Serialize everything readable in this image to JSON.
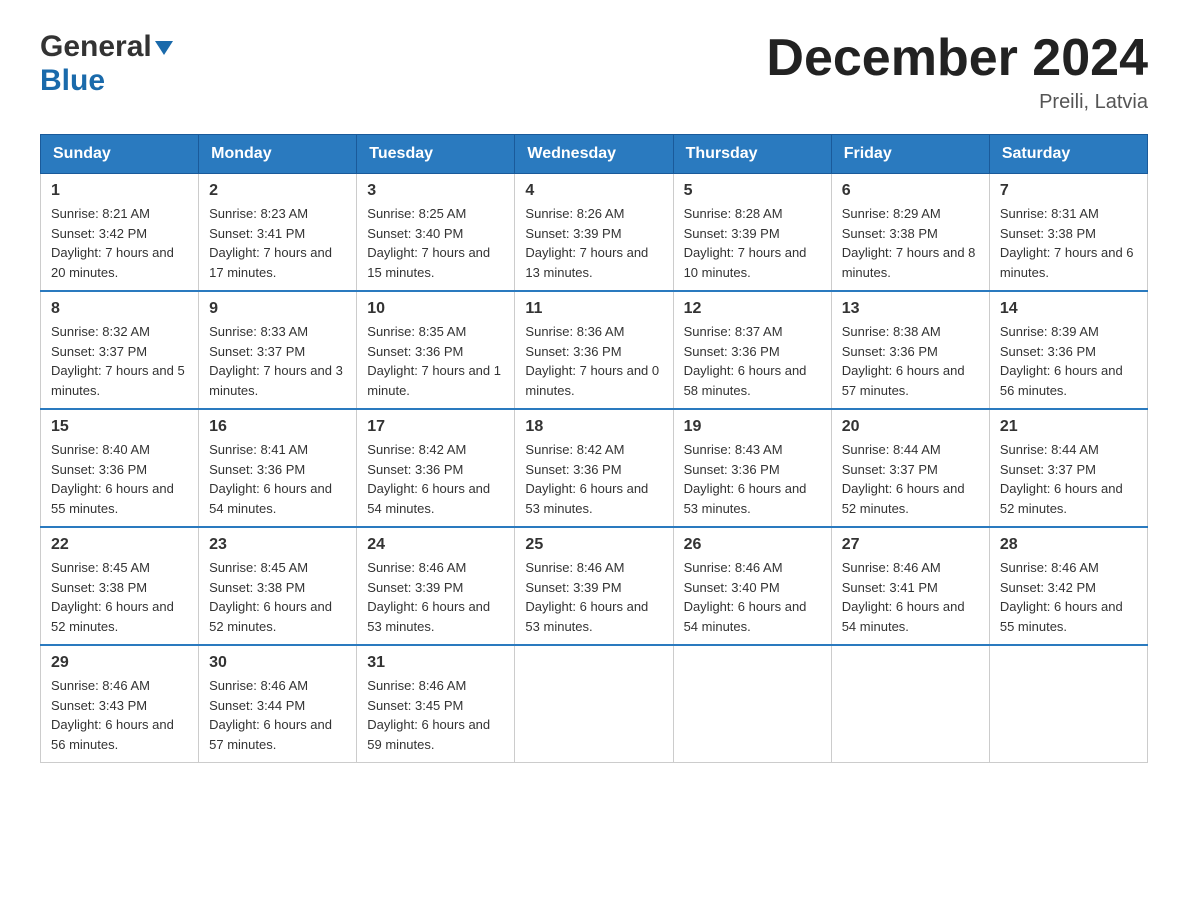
{
  "header": {
    "logo_general": "General",
    "logo_blue": "Blue",
    "title": "December 2024",
    "location": "Preili, Latvia"
  },
  "days_of_week": [
    "Sunday",
    "Monday",
    "Tuesday",
    "Wednesday",
    "Thursday",
    "Friday",
    "Saturday"
  ],
  "weeks": [
    [
      {
        "num": "1",
        "sunrise": "8:21 AM",
        "sunset": "3:42 PM",
        "daylight": "7 hours and 20 minutes."
      },
      {
        "num": "2",
        "sunrise": "8:23 AM",
        "sunset": "3:41 PM",
        "daylight": "7 hours and 17 minutes."
      },
      {
        "num": "3",
        "sunrise": "8:25 AM",
        "sunset": "3:40 PM",
        "daylight": "7 hours and 15 minutes."
      },
      {
        "num": "4",
        "sunrise": "8:26 AM",
        "sunset": "3:39 PM",
        "daylight": "7 hours and 13 minutes."
      },
      {
        "num": "5",
        "sunrise": "8:28 AM",
        "sunset": "3:39 PM",
        "daylight": "7 hours and 10 minutes."
      },
      {
        "num": "6",
        "sunrise": "8:29 AM",
        "sunset": "3:38 PM",
        "daylight": "7 hours and 8 minutes."
      },
      {
        "num": "7",
        "sunrise": "8:31 AM",
        "sunset": "3:38 PM",
        "daylight": "7 hours and 6 minutes."
      }
    ],
    [
      {
        "num": "8",
        "sunrise": "8:32 AM",
        "sunset": "3:37 PM",
        "daylight": "7 hours and 5 minutes."
      },
      {
        "num": "9",
        "sunrise": "8:33 AM",
        "sunset": "3:37 PM",
        "daylight": "7 hours and 3 minutes."
      },
      {
        "num": "10",
        "sunrise": "8:35 AM",
        "sunset": "3:36 PM",
        "daylight": "7 hours and 1 minute."
      },
      {
        "num": "11",
        "sunrise": "8:36 AM",
        "sunset": "3:36 PM",
        "daylight": "7 hours and 0 minutes."
      },
      {
        "num": "12",
        "sunrise": "8:37 AM",
        "sunset": "3:36 PM",
        "daylight": "6 hours and 58 minutes."
      },
      {
        "num": "13",
        "sunrise": "8:38 AM",
        "sunset": "3:36 PM",
        "daylight": "6 hours and 57 minutes."
      },
      {
        "num": "14",
        "sunrise": "8:39 AM",
        "sunset": "3:36 PM",
        "daylight": "6 hours and 56 minutes."
      }
    ],
    [
      {
        "num": "15",
        "sunrise": "8:40 AM",
        "sunset": "3:36 PM",
        "daylight": "6 hours and 55 minutes."
      },
      {
        "num": "16",
        "sunrise": "8:41 AM",
        "sunset": "3:36 PM",
        "daylight": "6 hours and 54 minutes."
      },
      {
        "num": "17",
        "sunrise": "8:42 AM",
        "sunset": "3:36 PM",
        "daylight": "6 hours and 54 minutes."
      },
      {
        "num": "18",
        "sunrise": "8:42 AM",
        "sunset": "3:36 PM",
        "daylight": "6 hours and 53 minutes."
      },
      {
        "num": "19",
        "sunrise": "8:43 AM",
        "sunset": "3:36 PM",
        "daylight": "6 hours and 53 minutes."
      },
      {
        "num": "20",
        "sunrise": "8:44 AM",
        "sunset": "3:37 PM",
        "daylight": "6 hours and 52 minutes."
      },
      {
        "num": "21",
        "sunrise": "8:44 AM",
        "sunset": "3:37 PM",
        "daylight": "6 hours and 52 minutes."
      }
    ],
    [
      {
        "num": "22",
        "sunrise": "8:45 AM",
        "sunset": "3:38 PM",
        "daylight": "6 hours and 52 minutes."
      },
      {
        "num": "23",
        "sunrise": "8:45 AM",
        "sunset": "3:38 PM",
        "daylight": "6 hours and 52 minutes."
      },
      {
        "num": "24",
        "sunrise": "8:46 AM",
        "sunset": "3:39 PM",
        "daylight": "6 hours and 53 minutes."
      },
      {
        "num": "25",
        "sunrise": "8:46 AM",
        "sunset": "3:39 PM",
        "daylight": "6 hours and 53 minutes."
      },
      {
        "num": "26",
        "sunrise": "8:46 AM",
        "sunset": "3:40 PM",
        "daylight": "6 hours and 54 minutes."
      },
      {
        "num": "27",
        "sunrise": "8:46 AM",
        "sunset": "3:41 PM",
        "daylight": "6 hours and 54 minutes."
      },
      {
        "num": "28",
        "sunrise": "8:46 AM",
        "sunset": "3:42 PM",
        "daylight": "6 hours and 55 minutes."
      }
    ],
    [
      {
        "num": "29",
        "sunrise": "8:46 AM",
        "sunset": "3:43 PM",
        "daylight": "6 hours and 56 minutes."
      },
      {
        "num": "30",
        "sunrise": "8:46 AM",
        "sunset": "3:44 PM",
        "daylight": "6 hours and 57 minutes."
      },
      {
        "num": "31",
        "sunrise": "8:46 AM",
        "sunset": "3:45 PM",
        "daylight": "6 hours and 59 minutes."
      },
      null,
      null,
      null,
      null
    ]
  ],
  "labels": {
    "sunrise": "Sunrise:",
    "sunset": "Sunset:",
    "daylight": "Daylight:"
  }
}
